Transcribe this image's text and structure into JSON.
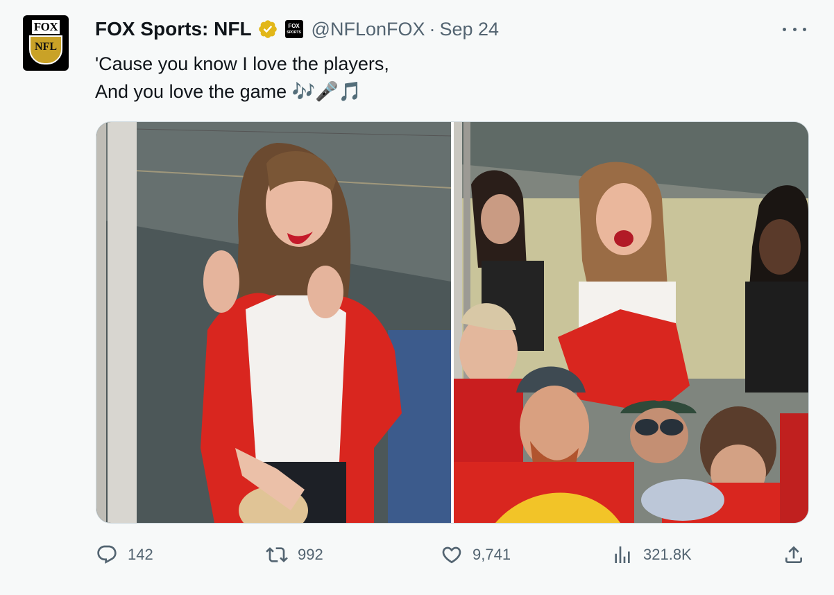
{
  "tweet": {
    "author_name": "FOX Sports: NFL",
    "handle": "@NFLonFOX",
    "separator": "·",
    "date": "Sep 24",
    "text_lines": [
      "'Cause you know I love the players,",
      "And you love the game 🎶🎤🎵"
    ],
    "avatar": {
      "top_text": "FOX",
      "bottom_text": "NFL"
    },
    "affiliate_badge": {
      "top": "FOX",
      "bottom": "SPORTS"
    }
  },
  "metrics": {
    "replies": "142",
    "retweets": "992",
    "likes": "9,741",
    "views": "321.8K"
  },
  "icons": [
    "verified-badge-icon",
    "more-icon",
    "reply-icon",
    "retweet-icon",
    "like-icon",
    "views-icon",
    "share-icon"
  ],
  "colors": {
    "background": "#f7f9f9",
    "text": "#0f1419",
    "secondary": "#536471",
    "verified_gold": "#e2b719",
    "chiefs_red": "#d9261f"
  }
}
